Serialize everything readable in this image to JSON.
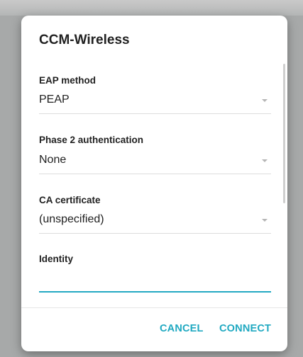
{
  "dialog": {
    "title": "CCM-Wireless",
    "fields": [
      {
        "label": "EAP method",
        "value": "PEAP"
      },
      {
        "label": "Phase 2 authentication",
        "value": "None"
      },
      {
        "label": "CA certificate",
        "value": "(unspecified)"
      }
    ],
    "identity": {
      "label": "Identity",
      "value": ""
    },
    "buttons": {
      "cancel": "CANCEL",
      "connect": "CONNECT"
    }
  },
  "colors": {
    "accent": "#20a9c1",
    "backdrop": "#a7a9a9",
    "dialog_bg": "#ffffff"
  }
}
